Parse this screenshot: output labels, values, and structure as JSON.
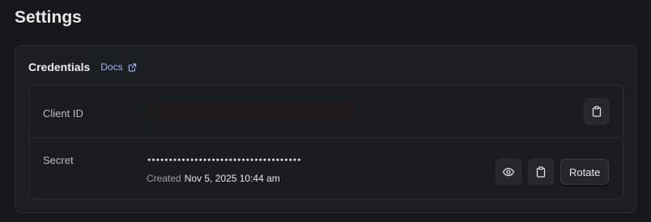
{
  "page": {
    "title": "Settings"
  },
  "credentials": {
    "title": "Credentials",
    "docs_label": "Docs",
    "client_id": {
      "label": "Client ID"
    },
    "secret": {
      "label": "Secret",
      "masked_value": "••••••••••••••••••••••••••••••••••••",
      "created_label": "Created",
      "created_value": "Nov 5, 2025 10:44 am",
      "rotate_label": "Rotate"
    }
  },
  "icons": {
    "docs": "external-link-icon",
    "copy": "clipboard-icon",
    "show": "eye-icon"
  },
  "colors": {
    "background": "#151718",
    "card": "#1c1f21",
    "link": "#9db3ff",
    "border": "#2a2e31"
  }
}
